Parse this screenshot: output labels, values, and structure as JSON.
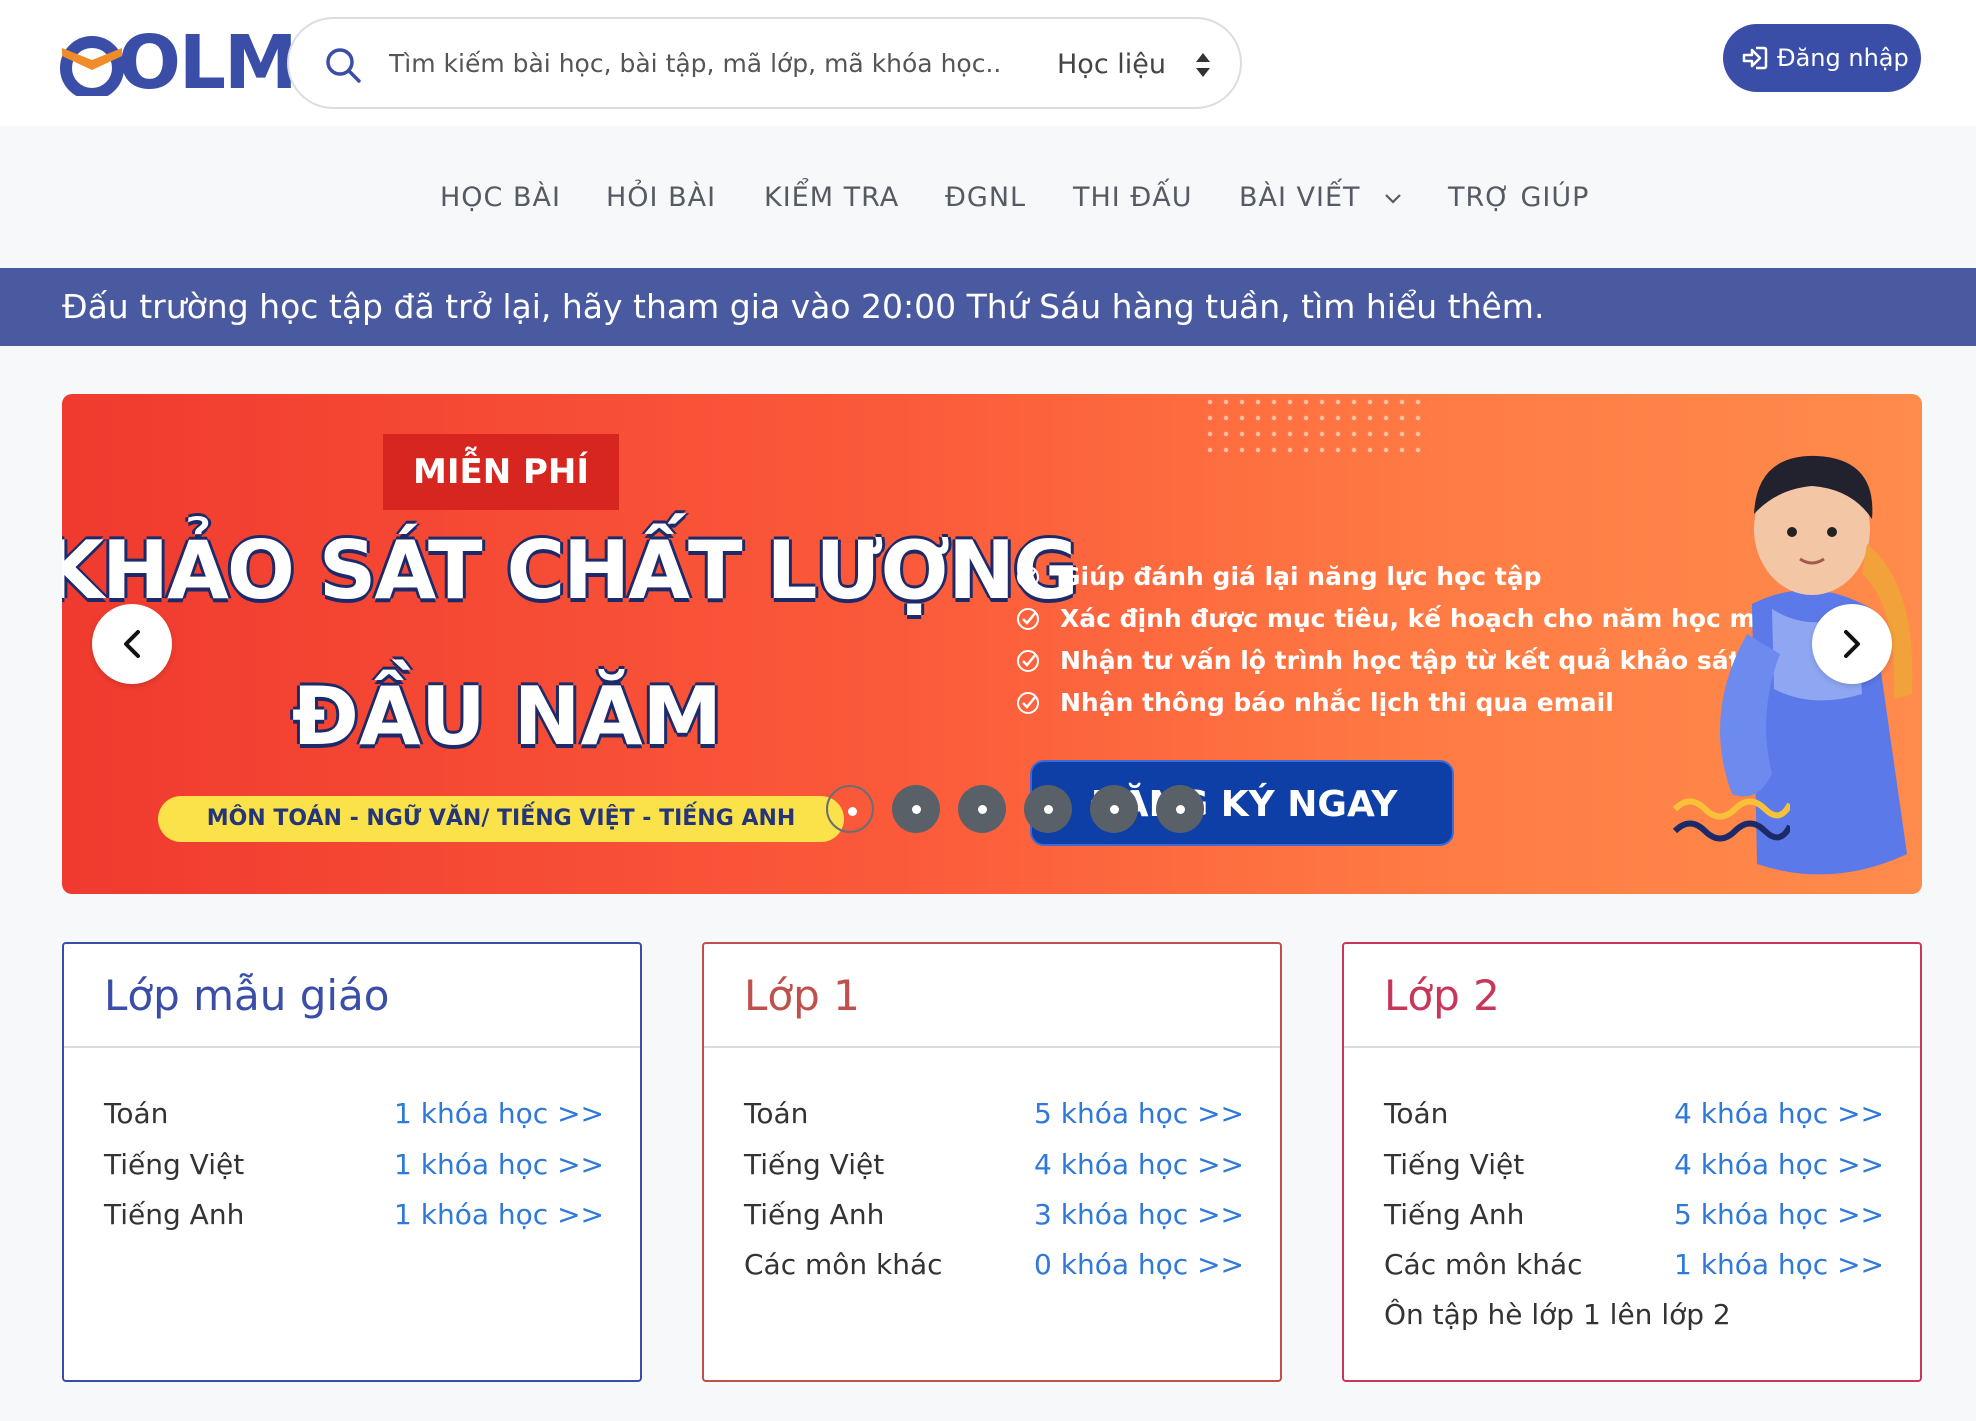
{
  "header": {
    "logo_text": "OLM",
    "search_placeholder": "Tìm kiếm bài học, bài tập, mã lớp, mã khóa học..",
    "search_type": "Học liệu",
    "login_label": "Đăng nhập"
  },
  "nav": {
    "items": [
      {
        "label": "HỌC BÀI"
      },
      {
        "label": "HỎI BÀI"
      },
      {
        "label": "KIỂM TRA"
      },
      {
        "label": "ĐGNL"
      },
      {
        "label": "THI ĐẤU"
      },
      {
        "label": "BÀI VIẾT",
        "has_dropdown": true
      },
      {
        "label": "TRỢ GIÚP"
      }
    ]
  },
  "announcement": "Đấu trường học tập đã trở lại, hãy tham gia vào 20:00 Thứ Sáu hàng tuần, tìm hiểu thêm.",
  "banner": {
    "badge": "MIỄN PHÍ",
    "title_line1": "KHẢO SÁT CHẤT LƯỢNG",
    "title_line2": "ĐẦU NĂM",
    "subjects": "MÔN TOÁN - NGỮ VĂN/ TIẾNG VIỆT - TIẾNG ANH",
    "benefits": [
      "Giúp đánh giá lại năng lực học tập",
      "Xác định được mục tiêu, kế hoạch cho năm học mới",
      "Nhận tư vấn lộ trình học tập từ kết quả khảo sát",
      "Nhận thông báo nhắc lịch thi qua email"
    ],
    "cta": "ĐĂNG KÝ NGAY",
    "slide_count": 6,
    "active_slide": 1
  },
  "cards": [
    {
      "title": "Lớp mẫu giáo",
      "color": "#3a4ea8",
      "rows": [
        {
          "subject": "Toán",
          "link": "1 khóa học >>"
        },
        {
          "subject": "Tiếng Việt",
          "link": "1 khóa học >>"
        },
        {
          "subject": "Tiếng Anh",
          "link": "1 khóa học >>"
        }
      ]
    },
    {
      "title": "Lớp 1",
      "color": "#c0504d",
      "rows": [
        {
          "subject": "Toán",
          "link": "5 khóa học >>"
        },
        {
          "subject": "Tiếng Việt",
          "link": "4 khóa học >>"
        },
        {
          "subject": "Tiếng Anh",
          "link": "3 khóa học >>"
        },
        {
          "subject": "Các môn khác",
          "link": "0 khóa học >>"
        }
      ]
    },
    {
      "title": "Lớp 2",
      "color": "#c8365a",
      "rows": [
        {
          "subject": "Toán",
          "link": "4 khóa học >>"
        },
        {
          "subject": "Tiếng Việt",
          "link": "4 khóa học >>"
        },
        {
          "subject": "Tiếng Anh",
          "link": "5 khóa học >>"
        },
        {
          "subject": "Các môn khác",
          "link": "1 khóa học >>"
        },
        {
          "subject": "Ôn tập hè lớp 1 lên lớp 2",
          "link": ""
        }
      ]
    }
  ],
  "colors": {
    "brand": "#3a4ea8",
    "announcement_bg": "#4a5aa1",
    "link": "#2f79d9"
  }
}
